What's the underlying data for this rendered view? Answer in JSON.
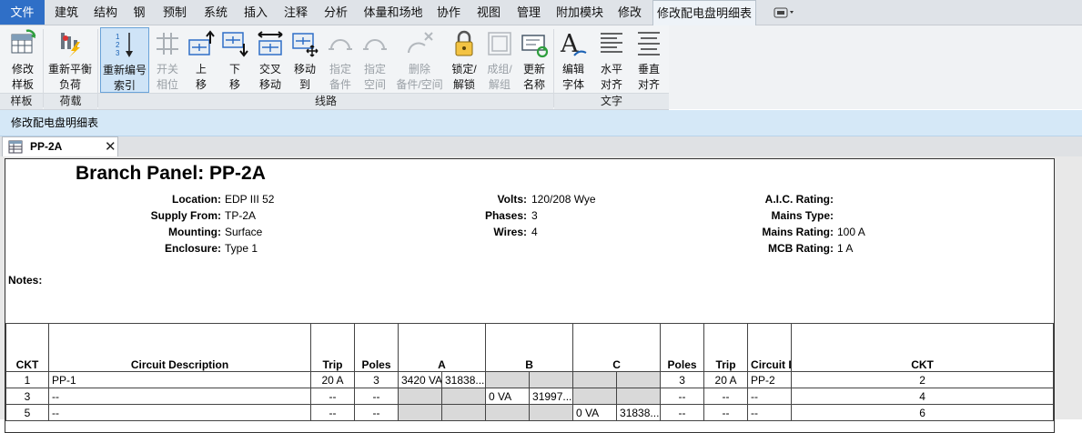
{
  "menu": {
    "file": "文件",
    "items": [
      "建筑",
      "结构",
      "钢",
      "预制",
      "系统",
      "插入",
      "注释",
      "分析",
      "体量和场地",
      "协作",
      "视图",
      "管理",
      "附加模块",
      "修改"
    ],
    "active": "修改配电盘明细表"
  },
  "ribbon": {
    "buttons": [
      {
        "label": "修改\n样板",
        "icon": "modify-template-icon"
      },
      {
        "label": "重新平衡\n负荷",
        "icon": "rebalance-load-icon"
      },
      {
        "label": "重新编号\n索引",
        "icon": "renumber-icon"
      },
      {
        "label": "开关\n相位",
        "icon": "toggle-phase-icon"
      },
      {
        "label": "上\n移",
        "icon": "move-up-icon"
      },
      {
        "label": "下\n移",
        "icon": "move-down-icon"
      },
      {
        "label": "交叉\n移动",
        "icon": "move-across-icon"
      },
      {
        "label": "移动\n到",
        "icon": "move-to-icon"
      },
      {
        "label": "指定\n备件",
        "icon": "assign-spare-icon"
      },
      {
        "label": "指定\n空间",
        "icon": "assign-space-icon"
      },
      {
        "label": "删除\n备件/空间",
        "icon": "remove-spare-icon"
      },
      {
        "label": "锁定/\n解锁",
        "icon": "lock-icon"
      },
      {
        "label": "成组/\n解组",
        "icon": "group-icon"
      },
      {
        "label": "更新\n名称",
        "icon": "update-names-icon"
      },
      {
        "label": "编辑\n字体",
        "icon": "edit-font-icon"
      },
      {
        "label": "水平\n对齐",
        "icon": "align-horizontal-icon"
      },
      {
        "label": "垂直\n对齐",
        "icon": "align-vertical-icon"
      }
    ],
    "groups": [
      "样板",
      "荷载",
      "线路",
      "文字"
    ]
  },
  "context_title": "修改配电盘明细表",
  "view_tab": {
    "label": "PP-2A",
    "close": "✕"
  },
  "panel": {
    "title": "Branch Panel: PP-2A",
    "location": {
      "label": "Location:",
      "value": "EDP III 52"
    },
    "supply": {
      "label": "Supply From:",
      "value": "TP-2A"
    },
    "mounting": {
      "label": "Mounting:",
      "value": "Surface"
    },
    "enclosure": {
      "label": "Enclosure:",
      "value": "Type 1"
    },
    "volts": {
      "label": "Volts:",
      "value": "120/208 Wye"
    },
    "phases": {
      "label": "Phases:",
      "value": "3"
    },
    "wires": {
      "label": "Wires:",
      "value": "4"
    },
    "aic": {
      "label": "A.I.C. Rating:",
      "value": ""
    },
    "mains_type": {
      "label": "Mains Type:",
      "value": ""
    },
    "mains_rating": {
      "label": "Mains Rating:",
      "value": "100 A"
    },
    "mcb": {
      "label": "MCB Rating:",
      "value": "1 A"
    },
    "notes_label": "Notes:"
  },
  "table": {
    "headers": [
      "CKT",
      "Circuit Description",
      "Trip",
      "Poles",
      "A",
      "B",
      "C",
      "Poles",
      "Trip",
      "Circuit Description",
      "CKT"
    ],
    "rows": [
      {
        "ckt_l": "1",
        "desc_l": "PP-1",
        "trip_l": "20 A",
        "poles_l": "3",
        "a1": "3420 VA",
        "a2": "31838...",
        "b1": "",
        "b2": "",
        "c1": "",
        "c2": "",
        "poles_r": "3",
        "trip_r": "20 A",
        "desc_r": "PP-2",
        "ckt_r": "2"
      },
      {
        "ckt_l": "3",
        "desc_l": "--",
        "trip_l": "--",
        "poles_l": "--",
        "a1": "",
        "a2": "",
        "b1": "0 VA",
        "b2": "31997...",
        "c1": "",
        "c2": "",
        "poles_r": "--",
        "trip_r": "--",
        "desc_r": "--",
        "ckt_r": "4"
      },
      {
        "ckt_l": "5",
        "desc_l": "--",
        "trip_l": "--",
        "poles_l": "--",
        "a1": "",
        "a2": "",
        "b1": "",
        "b2": "",
        "c1": "0 VA",
        "c2": "31838...",
        "poles_r": "--",
        "trip_r": "--",
        "desc_r": "--",
        "ckt_r": "6"
      }
    ]
  }
}
